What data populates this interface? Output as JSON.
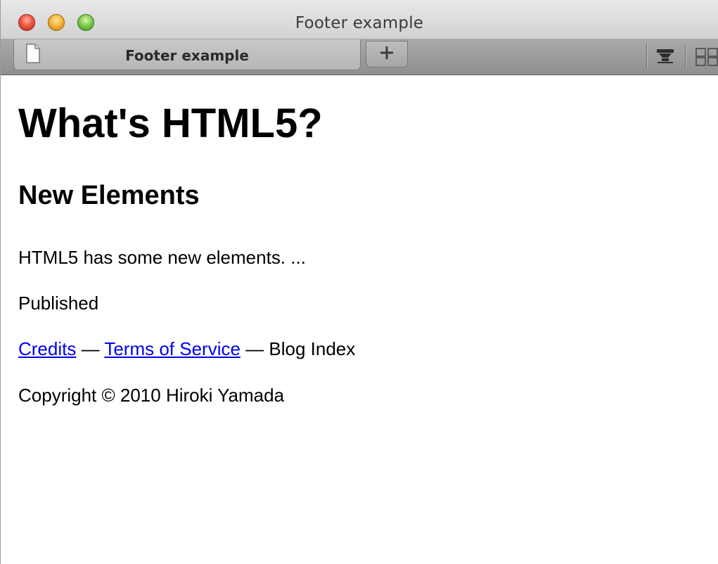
{
  "window": {
    "title": "Footer example"
  },
  "tabs": [
    {
      "label": "Footer example",
      "active": true
    }
  ],
  "toolbar": {
    "new_tab_icon": "plus-icon",
    "reader_icon": "reader-icon",
    "top_sites_icon": "grid-icon"
  },
  "page": {
    "heading": "What's HTML5?",
    "subheading": "New Elements",
    "paragraph": "HTML5 has some new elements. ...",
    "published": "Published",
    "footer_links": {
      "credits": "Credits",
      "separator1": " — ",
      "terms": "Terms of Service",
      "separator2": " — ",
      "blog_index": "Blog Index"
    },
    "copyright": "Copyright © 2010 Hiroki Yamada"
  },
  "colors": {
    "link": "#0000ee",
    "text": "#000000",
    "background": "#ffffff"
  }
}
